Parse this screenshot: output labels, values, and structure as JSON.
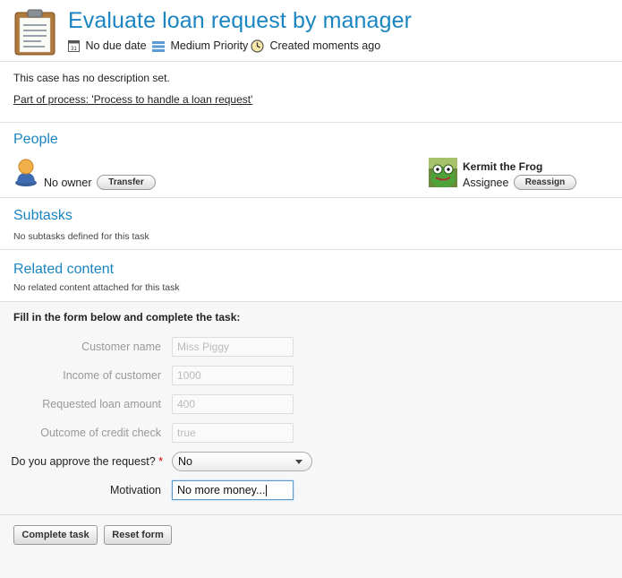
{
  "task": {
    "title": "Evaluate loan request by manager",
    "due": "No due date",
    "priority": "Medium Priority",
    "created": "Created moments ago",
    "icons": [
      "clipboard-icon",
      "calendar-icon",
      "priority-icon",
      "clock-icon"
    ]
  },
  "description": "This case has no description set.",
  "process_link": "Part of process: 'Process to handle a loan request'",
  "people": {
    "title": "People",
    "owner_text": "No owner",
    "transfer_label": "Transfer",
    "assignee_name": "Kermit the Frog",
    "assignee_role": "Assignee",
    "reassign_label": "Reassign",
    "icons": [
      "user-icon",
      "avatar"
    ]
  },
  "subtasks": {
    "title": "Subtasks",
    "empty_text": "No subtasks defined for this task"
  },
  "related": {
    "title": "Related content",
    "empty_text": "No related content attached for this task"
  },
  "form": {
    "heading": "Fill in the form below and complete the task:",
    "fields": [
      {
        "label": "Customer name",
        "value": "Miss Piggy"
      },
      {
        "label": "Income of customer",
        "value": "1000"
      },
      {
        "label": "Requested loan amount",
        "value": "400"
      },
      {
        "label": "Outcome of credit check",
        "value": "true"
      }
    ],
    "approve_label": "Do you approve the request?",
    "required_mark": "*",
    "approve_value": "No",
    "motivation_label": "Motivation",
    "motivation_value": "No more money..."
  },
  "buttons": {
    "complete": "Complete task",
    "reset": "Reset form"
  },
  "colors": {
    "accent": "#1a85c2",
    "required": "#dd0000"
  }
}
